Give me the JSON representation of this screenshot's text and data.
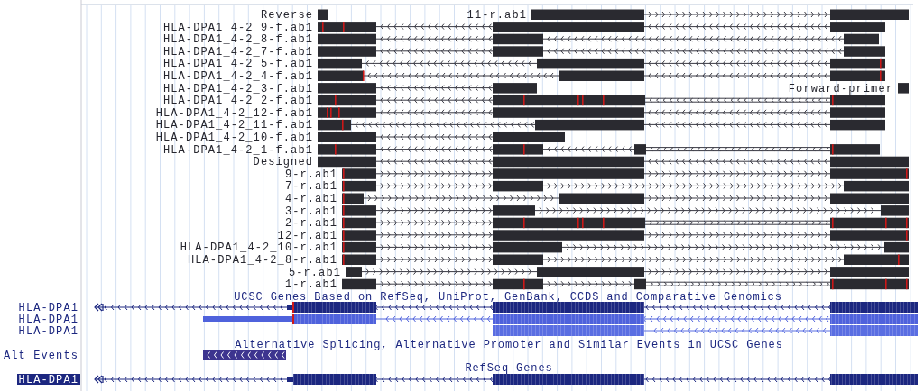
{
  "reads": [
    {
      "label": "Reverse"
    },
    {
      "label": "11-r.ab1",
      "reverse": false
    },
    {
      "label": "HLA-DPA1_4-2_9-f.ab1",
      "reverse": true
    },
    {
      "label": "HLA-DPA1_4-2_8-f.ab1",
      "reverse": true
    },
    {
      "label": "HLA-DPA1_4-2_7-f.ab1",
      "reverse": true
    },
    {
      "label": "HLA-DPA1_4-2_5-f.ab1",
      "reverse": true
    },
    {
      "label": "HLA-DPA1_4-2_4-f.ab1",
      "reverse": true
    },
    {
      "label": "HLA-DPA1_4-2_3-f.ab1",
      "reverse": true
    },
    {
      "label": "Forward-primer"
    },
    {
      "label": "HLA-DPA1_4-2_2-f.ab1",
      "reverse": true
    },
    {
      "label": "HLA-DPA1_4-2_12-f.ab1",
      "reverse": true
    },
    {
      "label": "HLA-DPA1_4-2_11-f.ab1",
      "reverse": true
    },
    {
      "label": "HLA-DPA1_4-2_10-f.ab1",
      "reverse": true
    },
    {
      "label": "HLA-DPA1_4-2_1-f.ab1",
      "reverse": true
    },
    {
      "label": "Designed",
      "reverse": true
    },
    {
      "label": "9-r.ab1",
      "reverse": false
    },
    {
      "label": "7-r.ab1",
      "reverse": false
    },
    {
      "label": "4-r.ab1",
      "reverse": false
    },
    {
      "label": "3-r.ab1",
      "reverse": false
    },
    {
      "label": "2-r.ab1",
      "reverse": false
    },
    {
      "label": "12-r.ab1",
      "reverse": false
    },
    {
      "label": "HLA-DPA1_4-2_10-r.ab1",
      "reverse": false
    },
    {
      "label": "HLA-DPA1_4-2_8-r.ab1",
      "reverse": false
    },
    {
      "label": "5-r.ab1",
      "reverse": false
    },
    {
      "label": "1-r.ab1",
      "reverse": false
    }
  ],
  "ucsc_genes": {
    "title": "UCSC Genes Based on RefSeq, UniProt, GenBank, CCDS and Comparative Genomics",
    "rows": [
      {
        "label": "HLA-DPA1",
        "highlighted": false
      },
      {
        "label": "HLA-DPA1",
        "highlighted": false
      },
      {
        "label": "HLA-DPA1",
        "highlighted": false
      }
    ]
  },
  "alt_events": {
    "title": "Alternative Splicing, Alternative Promoter and Similar Events in UCSC Genes",
    "label": "Alt Events"
  },
  "refseq_genes": {
    "title": "RefSeq Genes",
    "rows": [
      {
        "label": "HLA-DPA1",
        "highlighted": true
      }
    ]
  }
}
